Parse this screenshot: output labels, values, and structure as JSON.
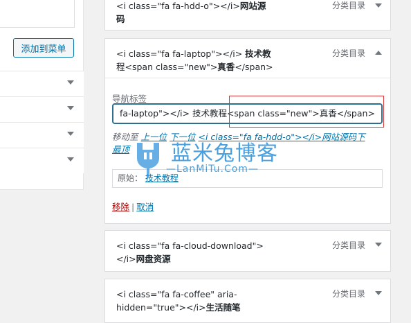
{
  "left_panel": {
    "add_to_menu_button": "添加到菜单"
  },
  "menu_items": [
    {
      "title_line1": "<i class=\"fa fa-hdd-o\"></i>",
      "title_line1_bold": "网站源",
      "title_line2_bold": "码",
      "type": "分类目录",
      "state": "collapsed"
    },
    {
      "title_line1": "<i class=\"fa fa-laptop\"></i> ",
      "title_line1_bold": "技术教",
      "title_line2": "程<span class=\"new\">",
      "title_line2_bold": "真香",
      "title_line2_tail": "</span>",
      "type": "分类目录",
      "state": "expanded",
      "nav_label_caption": "导航标签",
      "nav_label_value": "fa-laptop\"></i> 技术教程<span class=\"new\">真香</span>",
      "move_prefix": "移动至",
      "move_up": "上一位",
      "move_down": "下一位",
      "move_under": "<i class=\"fa fa-hdd-o\"></i>网站源码下",
      "move_top": "最顶",
      "original_label": "原始：",
      "original_link": "技术教程",
      "remove_label": "移除",
      "separator": "|",
      "cancel_label": "取消"
    },
    {
      "title_line1": "<i class=\"fa fa-cloud-download\">",
      "title_line2": "</i>",
      "title_line2_bold": "网盘资源",
      "type": "分类目录",
      "state": "collapsed"
    },
    {
      "title_line1": "<i class=\"fa fa-coffee\" aria-",
      "title_line2": "hidden=\"true\"></i>",
      "title_line2_bold": "生活随笔",
      "type": "分类目录",
      "state": "collapsed"
    }
  ],
  "watermark": {
    "title": "蓝米兔博客",
    "subtitle": "—LanMiTu.Com—",
    "color": "#2b8fd9"
  },
  "colors": {
    "accent": "#0073aa",
    "remove": "#aa0000",
    "highlight_frame": "#d63638"
  }
}
